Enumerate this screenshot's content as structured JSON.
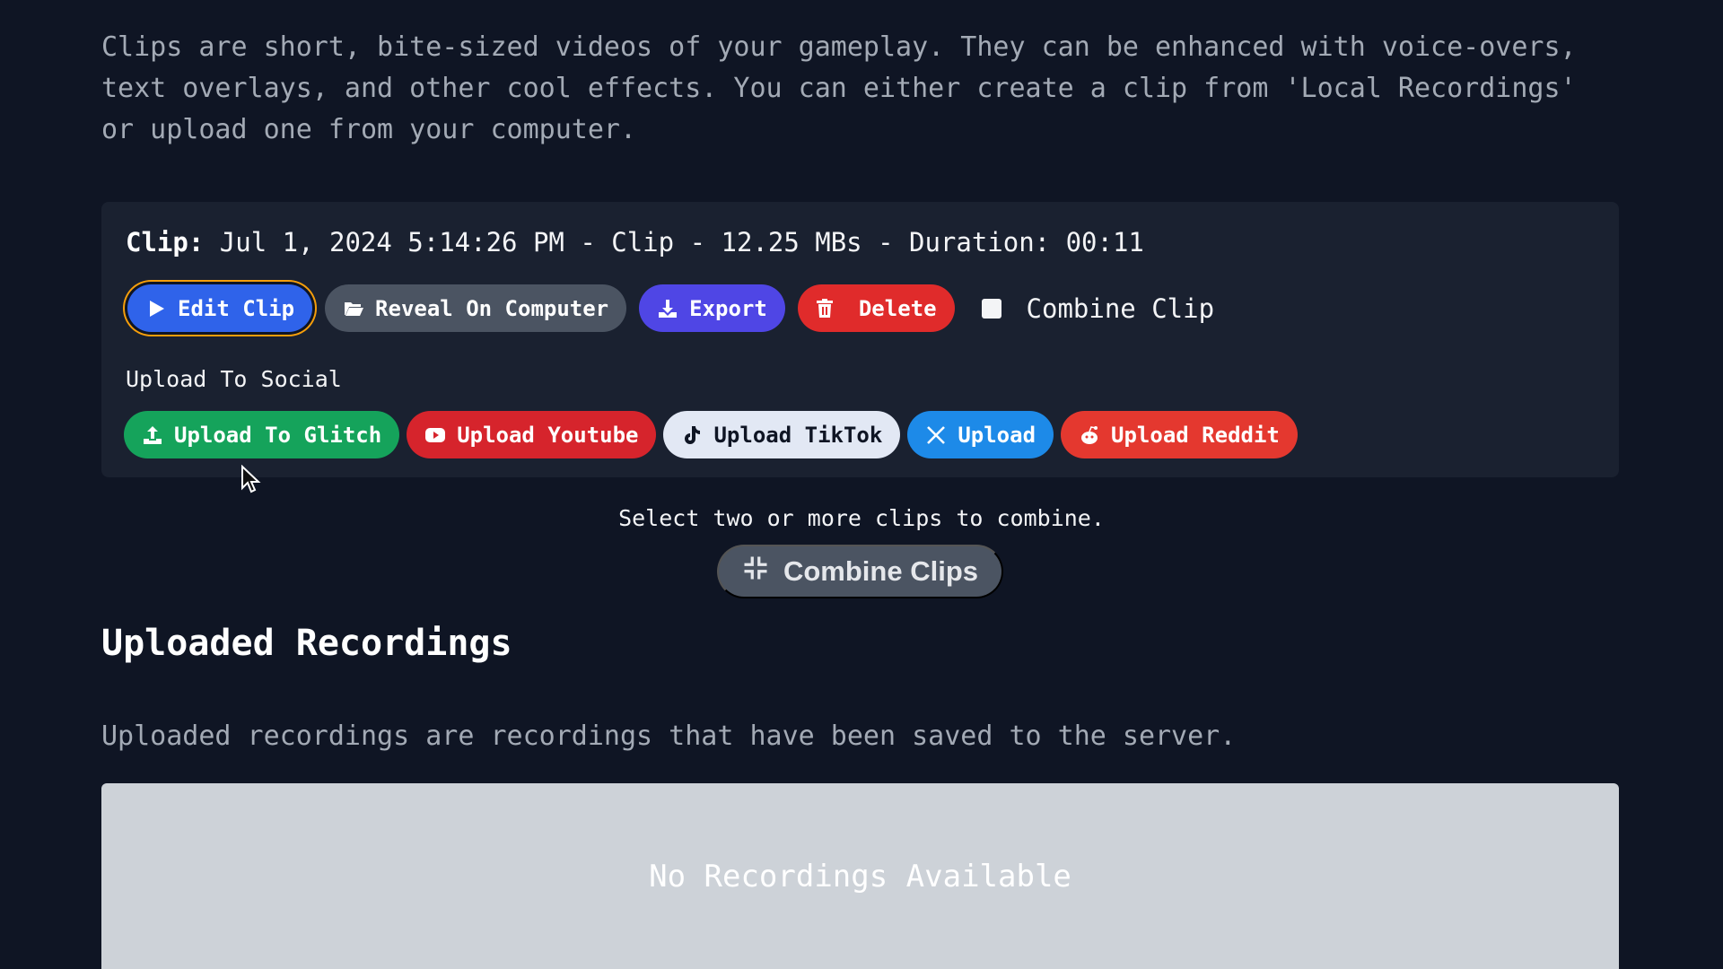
{
  "intro": {
    "line1": "Clips are short, bite-sized videos of your gameplay. They can be enhanced with voice-overs,",
    "line2": "text overlays, and other cool effects. You can either create a clip from 'Local Recordings'",
    "line3": "or upload one from your computer."
  },
  "clip": {
    "label": "Clip:",
    "details": "Jul 1, 2024 5:14:26 PM - Clip - 12.25 MBs - Duration: 00:11",
    "actions": {
      "edit": "Edit Clip",
      "reveal": "Reveal On Computer",
      "export": "Export",
      "delete": "Delete",
      "combine_checkbox": "Combine Clip"
    },
    "upload_label": "Upload To Social",
    "social": {
      "glitch": "Upload To Glitch",
      "youtube": "Upload Youtube",
      "tiktok": "Upload TikTok",
      "x": "Upload",
      "reddit": "Upload Reddit"
    }
  },
  "combine": {
    "hint": "Select two or more clips to combine.",
    "button": "Combine Clips"
  },
  "uploaded": {
    "title": "Uploaded Recordings",
    "description": "Uploaded recordings are recordings that have been saved to the server.",
    "empty": "No Recordings Available"
  },
  "colors": {
    "background": "#0f1524",
    "card": "#1a2130",
    "edit": "#2f63ea",
    "export": "#4f46e5",
    "delete": "#e02b2b",
    "glitch": "#15a35b",
    "youtube": "#d6242c",
    "x": "#1d8ae8",
    "reddit": "#e4382f"
  },
  "icons": [
    "play-icon",
    "folder-open-icon",
    "download-icon",
    "trash-icon",
    "upload-icon",
    "youtube-icon",
    "tiktok-icon",
    "x-logo-icon",
    "reddit-icon",
    "compress-icon",
    "mouse-cursor-icon"
  ]
}
